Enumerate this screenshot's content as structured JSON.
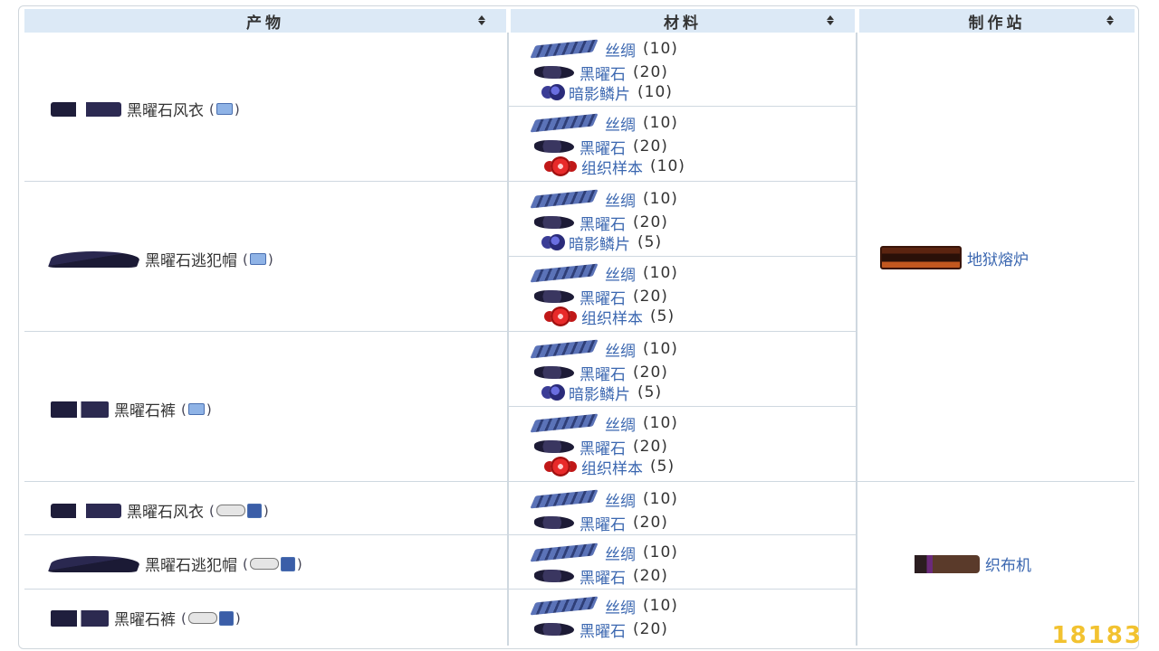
{
  "headers": {
    "product": "产物",
    "material": "材料",
    "station": "制作站"
  },
  "materials": {
    "silk": "丝绸",
    "obsidian": "黑曜石",
    "shadow_scale": "暗影鳞片",
    "tissue_sample": "组织样本"
  },
  "quantities": {
    "q10": "(10)",
    "q20": "(20)",
    "q5": "(5)"
  },
  "products": [
    {
      "name": "黑曜石风衣",
      "icon": "obsidian-coat-icon",
      "platform": "pc-mobile"
    },
    {
      "name": "黑曜石逃犯帽",
      "icon": "obsidian-hat-icon",
      "platform": "pc-mobile"
    },
    {
      "name": "黑曜石裤",
      "icon": "obsidian-pants-icon",
      "platform": "pc-mobile"
    },
    {
      "name": "黑曜石风衣",
      "icon": "obsidian-coat-icon",
      "platform": "console-3ds"
    },
    {
      "name": "黑曜石逃犯帽",
      "icon": "obsidian-hat-icon",
      "platform": "console-3ds"
    },
    {
      "name": "黑曜石裤",
      "icon": "obsidian-pants-icon",
      "platform": "console-3ds"
    }
  ],
  "stations": {
    "hellforge": "地狱熔炉",
    "loom": "织布机"
  },
  "watermark": "18183",
  "colors": {
    "header_bg": "#dce9f6",
    "link": "#3b67b0",
    "border": "#cfd8e0"
  }
}
